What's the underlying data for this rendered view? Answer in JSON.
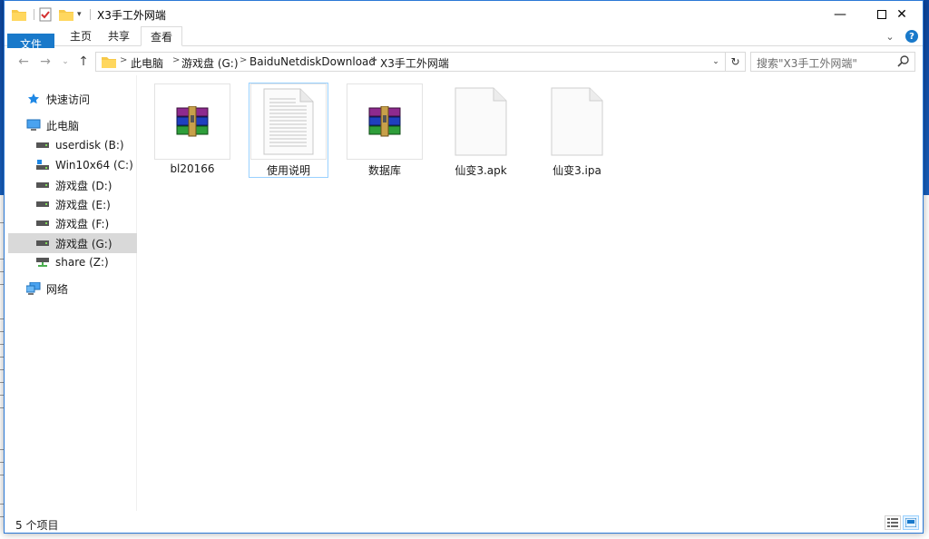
{
  "window": {
    "title": "X3手工外网端"
  },
  "ribbon": {
    "tabs": [
      {
        "label": "文件"
      },
      {
        "label": "主页"
      },
      {
        "label": "共享"
      },
      {
        "label": "查看"
      }
    ],
    "help": "?"
  },
  "address": {
    "crumbs": [
      "此电脑",
      "游戏盘 (G:)",
      "BaiduNetdiskDownload",
      "X3手工外网端"
    ]
  },
  "search": {
    "placeholder": "搜索\"X3手工外网端\""
  },
  "sidebar": {
    "items": [
      {
        "label": "快速访问",
        "icon": "star-icon"
      },
      {
        "label": "此电脑",
        "icon": "computer-icon"
      },
      {
        "label": "userdisk (B:)",
        "icon": "drive-icon"
      },
      {
        "label": "Win10x64 (C:)",
        "icon": "system-drive-icon"
      },
      {
        "label": "游戏盘 (D:)",
        "icon": "drive-icon"
      },
      {
        "label": "游戏盘 (E:)",
        "icon": "drive-icon"
      },
      {
        "label": "游戏盘 (F:)",
        "icon": "drive-icon"
      },
      {
        "label": "游戏盘 (G:)",
        "icon": "drive-icon"
      },
      {
        "label": "share (Z:)",
        "icon": "network-drive-icon"
      },
      {
        "label": "网络",
        "icon": "network-icon"
      }
    ],
    "selected_index": 7
  },
  "files": [
    {
      "name": "bl20166",
      "icon": "winrar-archive-icon"
    },
    {
      "name": "使用说明",
      "icon": "text-document-icon"
    },
    {
      "name": "数据库",
      "icon": "winrar-archive-icon"
    },
    {
      "name": "仙变3.apk",
      "icon": "blank-file-icon"
    },
    {
      "name": "仙变3.ipa",
      "icon": "blank-file-icon"
    }
  ],
  "selected_file_index": 1,
  "status": {
    "item_count": "5 个项目"
  },
  "colors": {
    "accent": "#1979ca",
    "selection": "#d9d9d9",
    "file_selection_border": "#99d1ff"
  }
}
